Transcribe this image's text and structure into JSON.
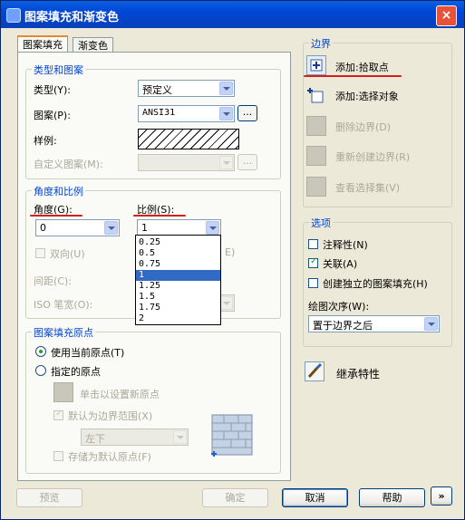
{
  "window": {
    "title": "图案填充和渐变色",
    "close": "×"
  },
  "tabs": [
    "图案填充",
    "渐变色"
  ],
  "type_pattern": {
    "group_title": "类型和图案",
    "type_label": "类型(Y):",
    "type_value": "预定义",
    "pattern_label": "图案(P):",
    "pattern_value": "ANSI31",
    "pattern_browse": "...",
    "sample_label": "样例:",
    "custom_label": "自定义图案(M):",
    "custom_browse": "..."
  },
  "angle_scale": {
    "group_title": "角度和比例",
    "angle_label": "角度(G):",
    "angle_value": "0",
    "scale_label": "比例(S):",
    "scale_value": "1",
    "scale_options": [
      "0.25",
      "0.5",
      "0.75",
      "1",
      "1.25",
      "1.5",
      "1.75",
      "2"
    ],
    "scale_selected_index": 3,
    "double_label": "双向(U)",
    "paperspace_fragment": "E)",
    "spacing_label": "间距(C):",
    "iso_label": "ISO 笔宽(O):"
  },
  "origin": {
    "group_title": "图案填充原点",
    "use_current": "使用当前原点(T)",
    "specified": "指定的原点",
    "click_set": "单击以设置新原点",
    "default_extents": "默认为边界范围(X)",
    "position_value": "左下",
    "store_default": "存储为默认原点(F)"
  },
  "boundary": {
    "group_title": "边界",
    "items": [
      {
        "label": "添加:拾取点",
        "enabled": true,
        "icon": "pick-point-icon"
      },
      {
        "label": "添加:选择对象",
        "enabled": true,
        "icon": "select-objects-icon"
      },
      {
        "label": "删除边界(D)",
        "enabled": false,
        "icon": "remove-boundary-icon"
      },
      {
        "label": "重新创建边界(R)",
        "enabled": false,
        "icon": "recreate-boundary-icon"
      },
      {
        "label": "查看选择集(V)",
        "enabled": false,
        "icon": "view-selections-icon"
      }
    ]
  },
  "options": {
    "group_title": "选项",
    "annotative": "注释性(N)",
    "associative": "关联(A)",
    "separate": "创建独立的图案填充(H)",
    "draw_order_label": "绘图次序(W):",
    "draw_order_value": "置于边界之后"
  },
  "inherit": "继承特性",
  "buttons": {
    "preview": "预览",
    "ok": "确定",
    "cancel": "取消",
    "help": "帮助",
    "more": "»"
  },
  "colors": {
    "accent_red": "#d0201c",
    "title_blue": "#0046d5",
    "select_blue": "#316ac5"
  }
}
